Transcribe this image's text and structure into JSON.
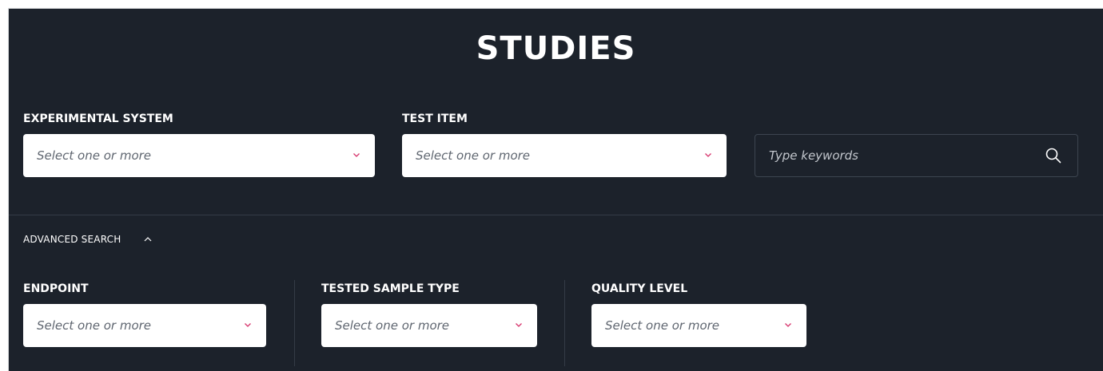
{
  "page": {
    "title": "STUDIES"
  },
  "filters": {
    "experimental_system": {
      "label": "EXPERIMENTAL SYSTEM",
      "placeholder": "Select one or more"
    },
    "test_item": {
      "label": "TEST ITEM",
      "placeholder": "Select one or more"
    }
  },
  "search": {
    "placeholder": "Type keywords",
    "icon": "search-icon"
  },
  "advanced": {
    "label": "ADVANCED SEARCH",
    "icon": "chevron-up-icon",
    "filters": {
      "endpoint": {
        "label": "ENDPOINT",
        "placeholder": "Select one or more"
      },
      "tested_sample_type": {
        "label": "TESTED SAMPLE TYPE",
        "placeholder": "Select one or more"
      },
      "quality_level": {
        "label": "QUALITY LEVEL",
        "placeholder": "Select one or more"
      }
    }
  },
  "colors": {
    "background": "#1c222b",
    "accent_chevron": "#d6336c",
    "text": "#ffffff"
  }
}
